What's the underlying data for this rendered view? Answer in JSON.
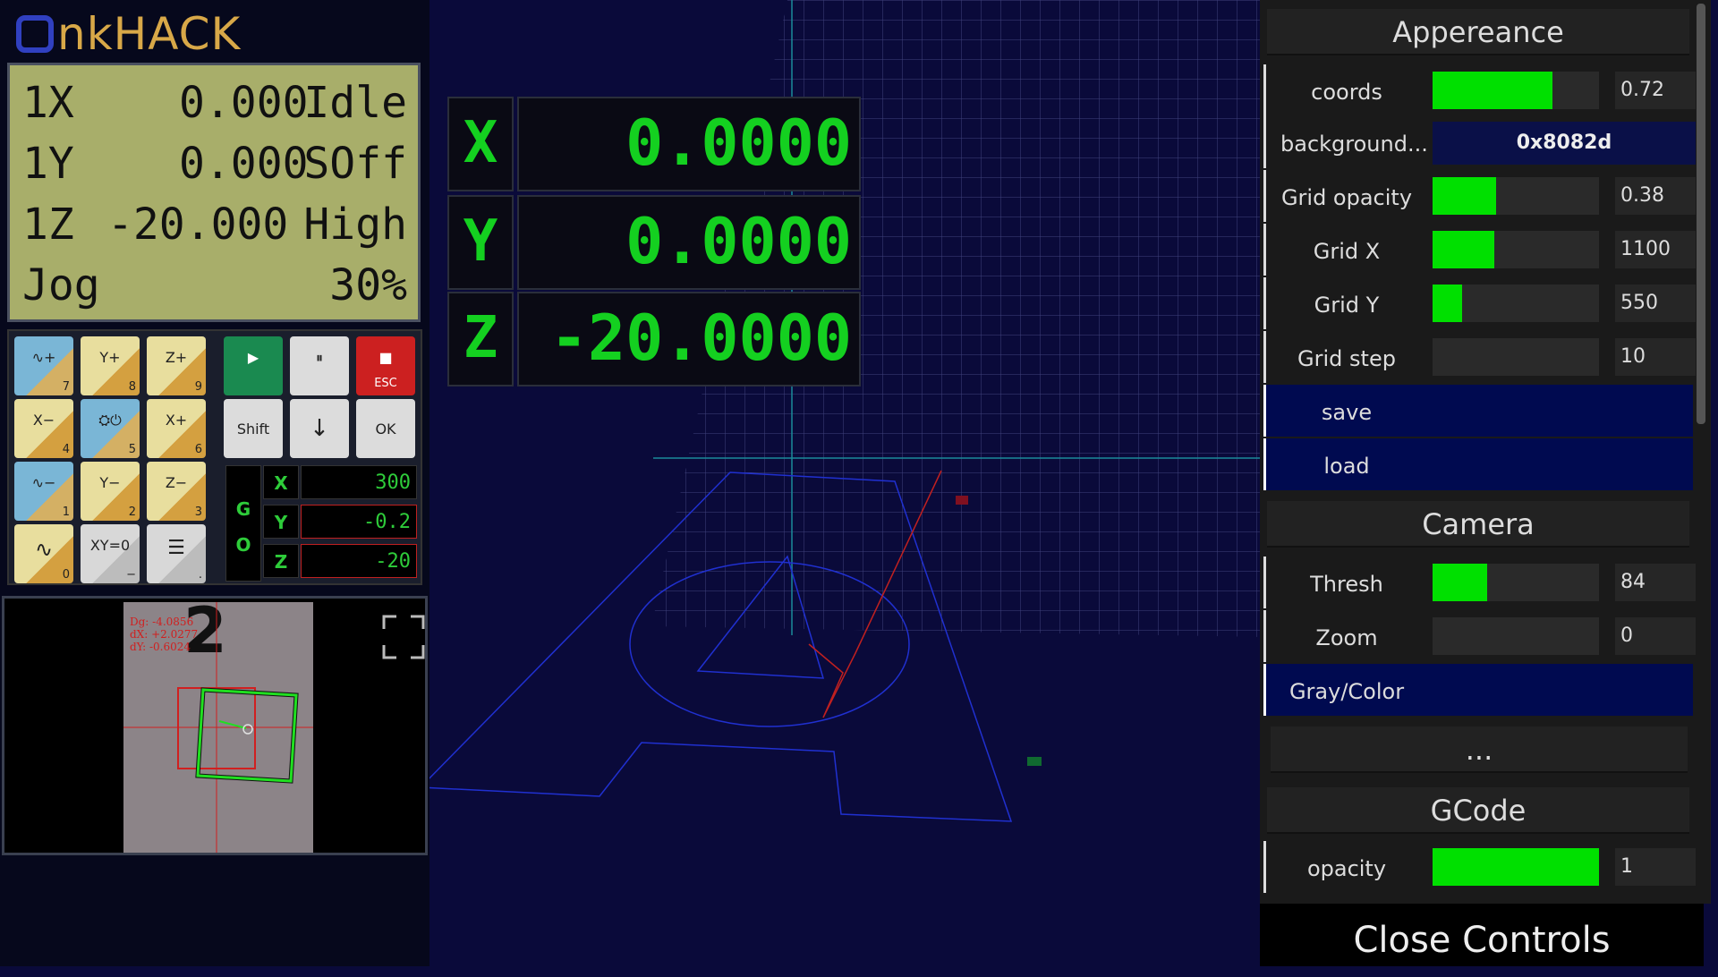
{
  "app": {
    "logo_prefix": "o",
    "logo_text": "nkHACK",
    "logo_o_color": "#3040c0",
    "logo_text_color": "#d8a848"
  },
  "lcd": {
    "rows": [
      {
        "a": "1X",
        "b": "0.000",
        "c": "Idle"
      },
      {
        "a": "1Y",
        "b": "0.000",
        "c": "SOff"
      },
      {
        "a": "1Z",
        "b": "-20.000",
        "c": "High"
      },
      {
        "a": "Jog",
        "b": "",
        "c": "30%"
      }
    ]
  },
  "keypad": {
    "keys": [
      {
        "label": "∿+",
        "num": "7"
      },
      {
        "label": "Y+",
        "num": "8"
      },
      {
        "label": "Z+",
        "num": "9"
      },
      {
        "label": "▶",
        "num": ""
      },
      {
        "label": "⏸",
        "num": ""
      },
      {
        "label": "■",
        "num": "ESC"
      },
      {
        "label": "X−",
        "num": "4"
      },
      {
        "label": "⛭⏻",
        "num": "5"
      },
      {
        "label": "X+",
        "num": "6"
      },
      {
        "label": "Shift",
        "num": ""
      },
      {
        "label": "↓",
        "num": ""
      },
      {
        "label": "OK",
        "num": ""
      },
      {
        "label": "∿−",
        "num": "1"
      },
      {
        "label": "Y−",
        "num": "2"
      },
      {
        "label": "Z−",
        "num": "3"
      },
      {
        "label": "∿",
        "num": "0"
      },
      {
        "label": "XY=0",
        "num": "−"
      },
      {
        "label": "☰",
        "num": "."
      }
    ],
    "go_letters": "G O",
    "go": [
      {
        "axis": "X",
        "value": "300"
      },
      {
        "axis": "Y",
        "value": "-0.2"
      },
      {
        "axis": "Z",
        "value": "-20"
      }
    ]
  },
  "camera": {
    "overlay": [
      "Dg: -4.0856",
      "dX: +2.0277",
      "dY: -0.6024"
    ],
    "digit": "2"
  },
  "dro": [
    {
      "axis": "X",
      "value": "0.0000"
    },
    {
      "axis": "Y",
      "value": "0.0000"
    },
    {
      "axis": "Z",
      "value": "-20.0000"
    }
  ],
  "controls": {
    "appearance_title": "Appereance",
    "coords": {
      "label": "coords",
      "value": "0.72",
      "level": 0.72
    },
    "background": {
      "label": "background...",
      "value": "0x8082d"
    },
    "grid_opacity": {
      "label": "Grid opacity",
      "value": "0.38",
      "level": 0.38
    },
    "grid_x": {
      "label": "Grid X",
      "value": "1100",
      "level": 0.37
    },
    "grid_y": {
      "label": "Grid Y",
      "value": "550",
      "level": 0.18
    },
    "grid_step": {
      "label": "Grid step",
      "value": "10",
      "level": 0.0
    },
    "save": "save",
    "load": "load",
    "camera_title": "Camera",
    "thresh": {
      "label": "Thresh",
      "value": "84",
      "level": 0.33
    },
    "zoom": {
      "label": "Zoom",
      "value": "0",
      "level": 0.0
    },
    "gray_color": "Gray/Color",
    "more": "...",
    "gcode_title": "GCode",
    "opacity": {
      "label": "opacity",
      "value": "1",
      "level": 1.0
    },
    "close": "Close Controls"
  },
  "colors": {
    "accent_green": "#00e000",
    "dro_green": "#14d020",
    "scene_bg": "#0a0a3a"
  }
}
